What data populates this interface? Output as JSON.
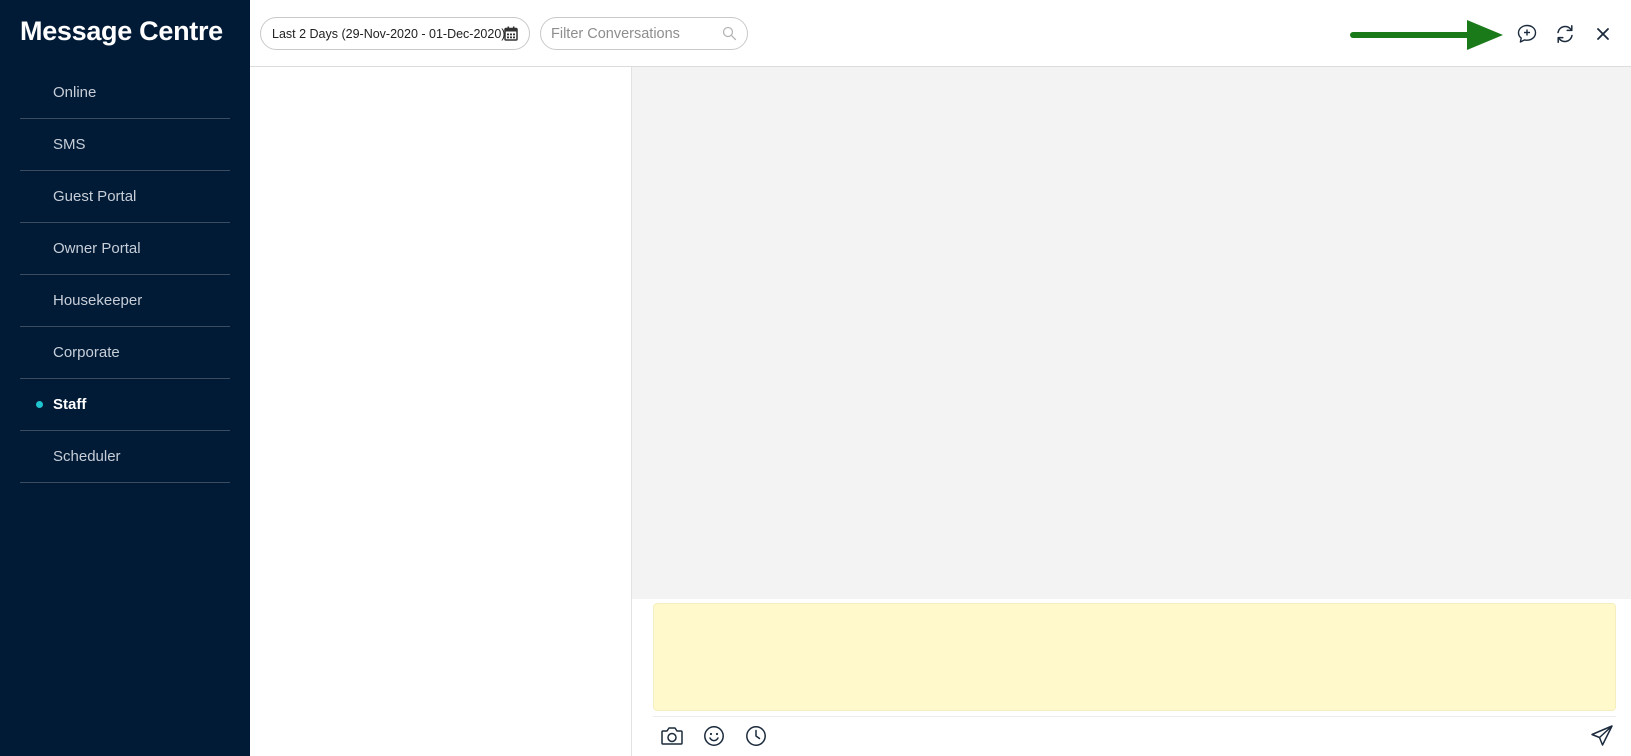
{
  "sidebar": {
    "title": "Message Centre",
    "items": [
      {
        "label": "Online",
        "active": false
      },
      {
        "label": "SMS",
        "active": false
      },
      {
        "label": "Guest Portal",
        "active": false
      },
      {
        "label": "Owner Portal",
        "active": false
      },
      {
        "label": "Housekeeper",
        "active": false
      },
      {
        "label": "Corporate",
        "active": false
      },
      {
        "label": "Staff",
        "active": true
      },
      {
        "label": "Scheduler",
        "active": false
      }
    ]
  },
  "toolbar": {
    "date_range": "Last 2 Days (29-Nov-2020 - 01-Dec-2020)",
    "filter_placeholder": "Filter Conversations",
    "icons": [
      "calendar-icon",
      "search-icon",
      "new-message-icon",
      "refresh-icon",
      "close-icon"
    ]
  },
  "composer": {
    "icons": [
      "camera-icon",
      "emoji-icon",
      "clock-icon",
      "send-icon"
    ]
  },
  "colors": {
    "sidebar_bg": "#011a36",
    "active_dot": "#20c4cf",
    "thread_bg": "#f3f3f3",
    "compose_bg": "#fff9cc",
    "annotation_arrow": "#1a7a1a"
  }
}
